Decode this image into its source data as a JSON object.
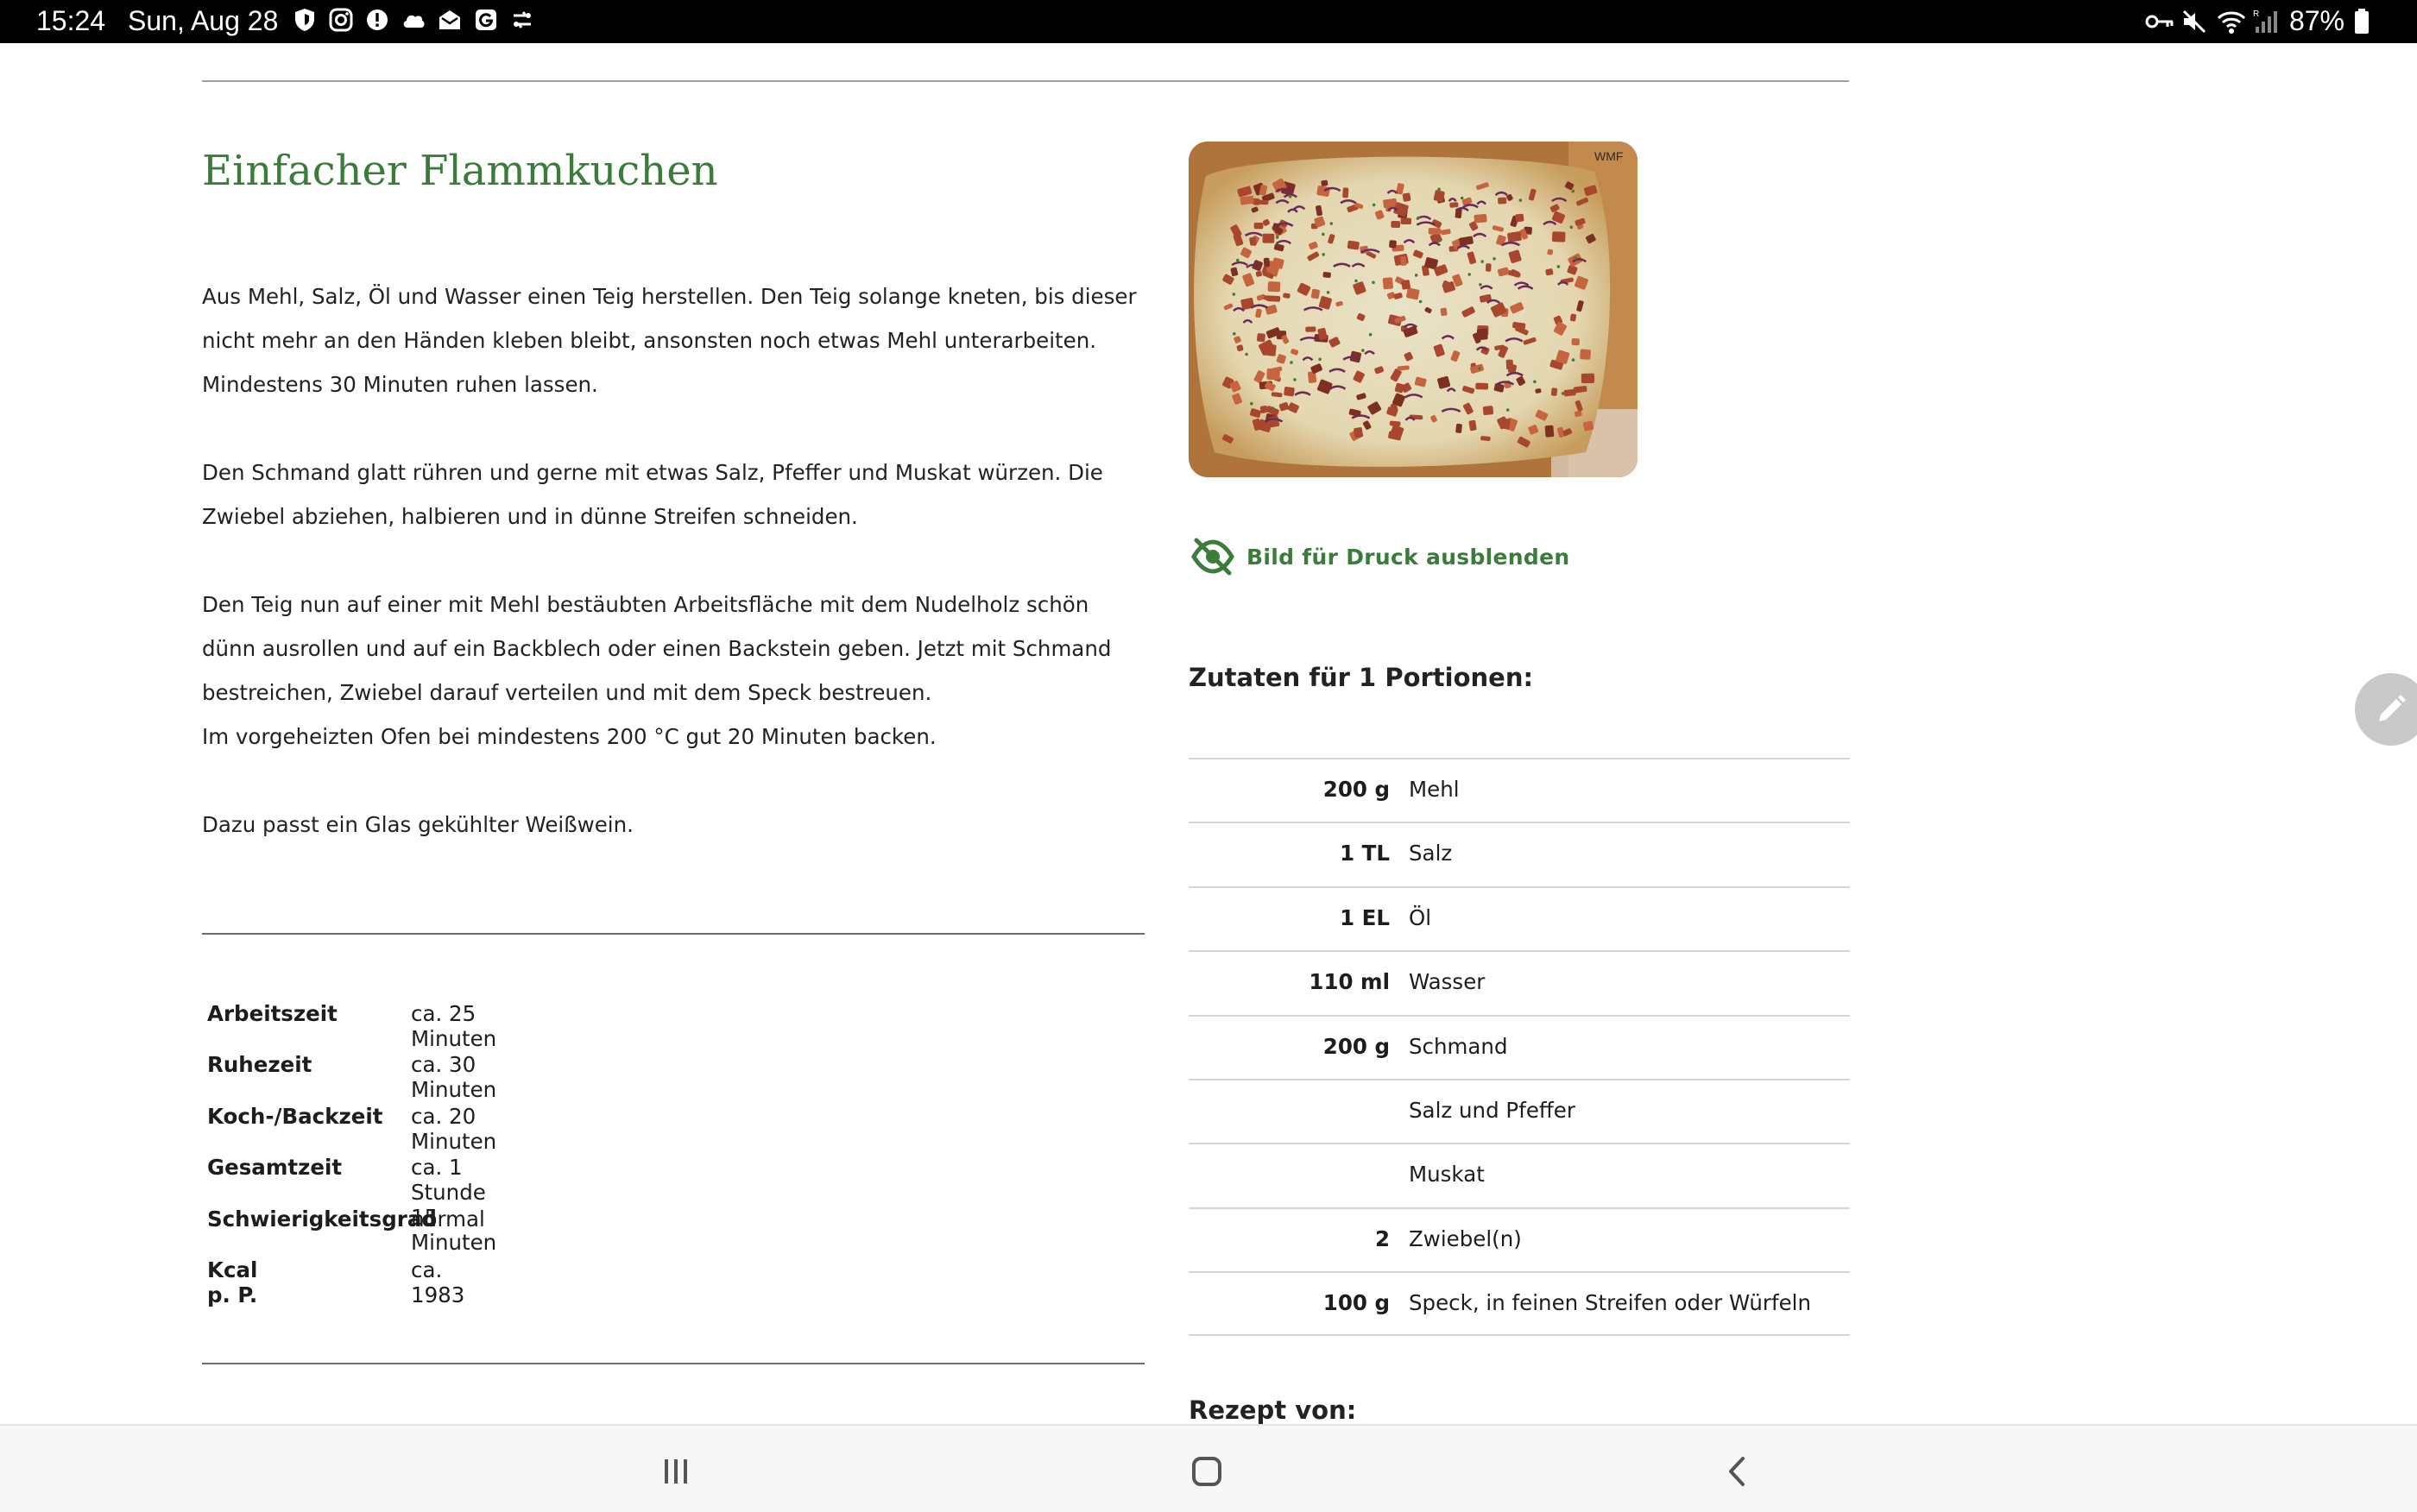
{
  "status_bar": {
    "time": "15:24",
    "date": "Sun, Aug 28",
    "battery": "87%",
    "left_icons": [
      "shield-icon",
      "instagram-icon",
      "alert-icon",
      "cloud-icon",
      "mail-icon",
      "google-icon",
      "sync-icon"
    ],
    "right_icons": [
      "vpn-key-icon",
      "mute-icon",
      "wifi-icon",
      "signal-icon",
      "battery-icon"
    ]
  },
  "recipe": {
    "title": "Einfacher Flammkuchen",
    "instructions": {
      "p1": "Aus Mehl, Salz, Öl und Wasser einen Teig herstellen. Den Teig solange kneten, bis dieser nicht mehr an den Händen kleben bleibt, ansonsten noch etwas Mehl unterarbeiten. Mindestens 30 Minuten ruhen lassen.",
      "p2": "Den Schmand glatt rühren und gerne mit etwas Salz, Pfeffer und Muskat würzen. Die Zwiebel abziehen, halbieren und in dünne Streifen schneiden.",
      "p3": "Den Teig nun auf einer mit Mehl bestäubten Arbeitsfläche mit dem Nudelholz schön dünn ausrollen und auf ein Backblech oder einen Backstein geben. Jetzt mit Schmand bestreichen, Zwiebel darauf verteilen und mit dem Speck bestreuen.",
      "p4": "Im vorgeheizten Ofen bei mindestens 200 °C gut 20 Minuten backen.",
      "p5": "Dazu passt ein Glas gekühlter Weißwein."
    },
    "times": [
      {
        "label": "Arbeitszeit",
        "value": "ca. 25 Minuten"
      },
      {
        "label": "Ruhezeit",
        "value": "ca. 30 Minuten"
      },
      {
        "label": "Koch-/Backzeit",
        "value": "ca. 20 Minuten"
      },
      {
        "label": "Gesamtzeit",
        "value": "ca. 1 Stunde 15 Minuten"
      },
      {
        "label": "Schwierigkeitsgrad",
        "value": "normal"
      },
      {
        "label": "Kcal p. P.",
        "value": "ca. 1983"
      }
    ],
    "hide_image_label": "Bild für Druck ausblenden",
    "ingredients_title": "Zutaten für 1 Portionen:",
    "ingredients": [
      {
        "amount": "200 g",
        "name": "Mehl"
      },
      {
        "amount": "1 TL",
        "name": "Salz"
      },
      {
        "amount": "1 EL",
        "name": "Öl"
      },
      {
        "amount": "110 ml",
        "name": "Wasser"
      },
      {
        "amount": "200 g",
        "name": "Schmand"
      },
      {
        "amount": "",
        "name": "Salz und Pfeffer"
      },
      {
        "amount": "",
        "name": "Muskat"
      },
      {
        "amount": "2",
        "name": "Zwiebel(n)"
      },
      {
        "amount": "100 g",
        "name": "Speck, in feinen Streifen oder Würfeln"
      }
    ],
    "rezept_von": "Rezept von:",
    "photo_logo": "WMF"
  },
  "colors": {
    "accent_green": "#3a7d3a",
    "status_bar_bg": "#000000",
    "fab_bg": "#c9c9c9"
  },
  "nav_bar": {
    "icons": [
      "recent-apps-icon",
      "home-icon",
      "back-icon"
    ]
  }
}
